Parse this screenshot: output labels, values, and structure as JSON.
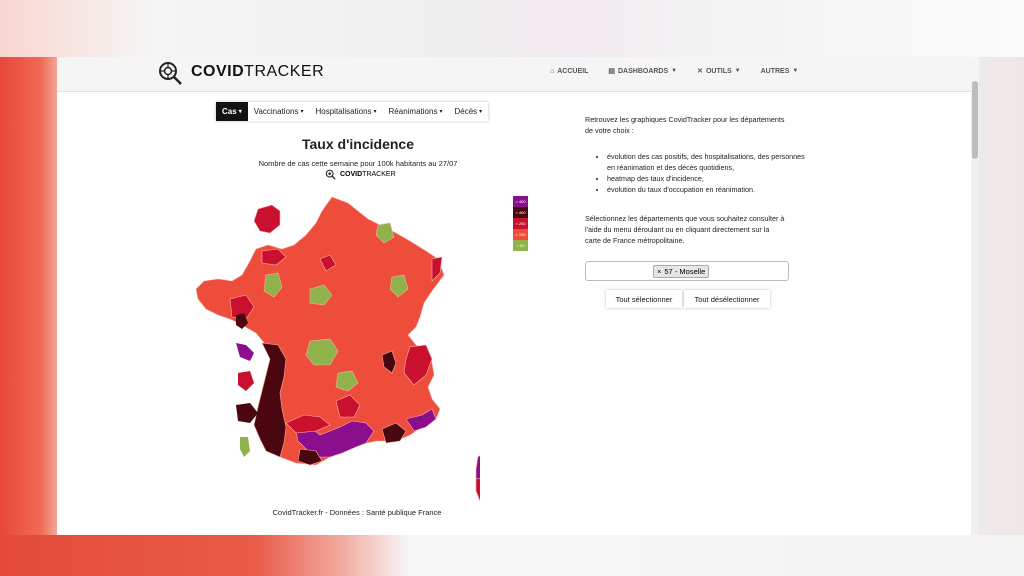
{
  "navbar": {
    "brand_bold": "COVID",
    "brand_regular": "TRACKER",
    "links": [
      {
        "label": "ACCUEIL",
        "icon": "home-icon"
      },
      {
        "label": "DASHBOARDS",
        "icon": "chart-icon"
      },
      {
        "label": "OUTILS",
        "icon": "tools-icon"
      },
      {
        "label": "AUTRES",
        "icon": ""
      }
    ]
  },
  "tabs": [
    "Cas",
    "Vaccinations",
    "Hospitalisations",
    "Réanimations",
    "Décès"
  ],
  "map": {
    "title": "Taux d'incidence",
    "subtitle": "Nombre de cas cette semaine pour 100k habitants au 27/07",
    "mini_brand_bold": "COVID",
    "mini_brand_regular": "TRACKER",
    "legend": [
      {
        "label": "> 400",
        "color": "#8b0f8c"
      },
      {
        "label": "< 400",
        "color": "#4a0710"
      },
      {
        "label": "< 250",
        "color": "#c9102e"
      },
      {
        "label": "< 150",
        "color": "#ef4d3b"
      },
      {
        "label": "< 50",
        "color": "#8fb34a"
      }
    ],
    "footer": "CovidTracker.fr - Données : Santé publique France"
  },
  "panel": {
    "intro": "Retrouvez les graphiques CovidTracker pour les départements de votre choix :",
    "bullets": [
      "évolution des cas positifs, des hospitalisations, des personnes en réanimation et des décès quotidiens,",
      "heatmap des taux d'incidence,",
      "évolution du taux d'occupation en réanimation."
    ],
    "select_text": "Sélectionnez les départements que vous souhaitez consulter à l'aide du menu déroulant ou en cliquant directement sur la carte de France métropolitaine.",
    "selected_chip": "57 - Moselle",
    "chip_remove": "×",
    "select_all": "Tout sélectionner",
    "deselect_all": "Tout désélectionner"
  },
  "colors": {
    "purple": "#8b0f8c",
    "dark": "#4a0710",
    "red": "#c9102e",
    "orange": "#ef4d3b",
    "green": "#8fb34a"
  }
}
